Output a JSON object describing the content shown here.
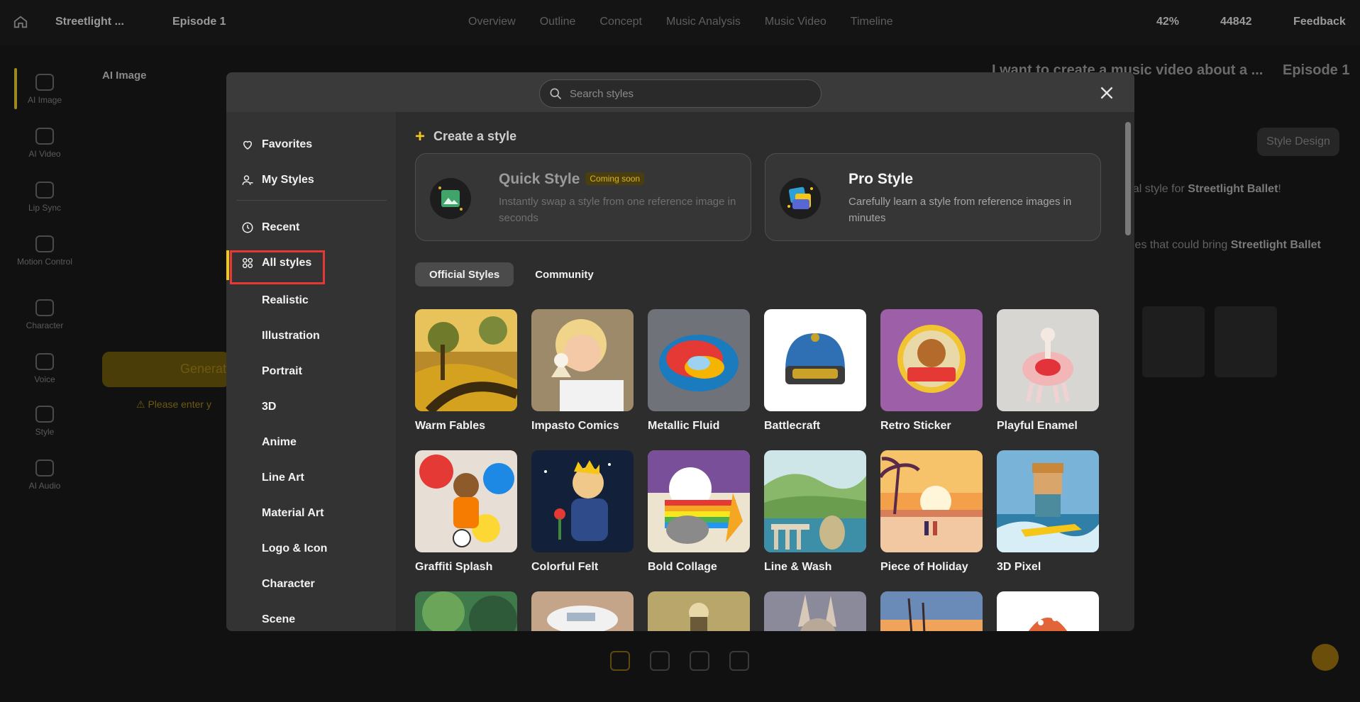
{
  "app": {
    "project": "Streetlight ...",
    "episode": "Episode 1",
    "nav": [
      "Overview",
      "Outline",
      "Concept",
      "Music Analysis",
      "Music Video",
      "Timeline"
    ],
    "zoom": "42%",
    "credits": "44842",
    "feedback": "Feedback"
  },
  "left_rail": [
    "AI Image",
    "AI Video",
    "Lip Sync",
    "Motion Control",
    "Character",
    "Voice",
    "Style",
    "AI Audio"
  ],
  "left_panel": {
    "title": "AI Image",
    "generate": "Generate",
    "warning": "Please enter y"
  },
  "right_panel": {
    "title": "I want to create a music video about a ...",
    "episode": "Episode 1",
    "style_design": "Style Design",
    "text1_pre": "ual style for ",
    "text1_bold": "Streetlight Ballet",
    "text1_post": "!",
    "text2_pre": "yles that could bring ",
    "text2_bold": "Streetlight Ballet"
  },
  "modal": {
    "search_placeholder": "Search styles",
    "sidebar": {
      "favorites": "Favorites",
      "my_styles": "My Styles",
      "recent": "Recent",
      "all_styles": "All styles",
      "categories": [
        "Realistic",
        "Illustration",
        "Portrait",
        "3D",
        "Anime",
        "Line Art",
        "Material Art",
        "Logo & Icon",
        "Character",
        "Scene"
      ]
    },
    "create_style": "Create a style",
    "quick_style": {
      "title": "Quick Style",
      "badge": "Coming soon",
      "desc": "Instantly swap a style from one reference image in seconds"
    },
    "pro_style": {
      "title": "Pro Style",
      "desc": "Carefully learn a style from reference images in minutes"
    },
    "tabs": [
      "Official Styles",
      "Community"
    ],
    "styles": [
      "Warm Fables",
      "Impasto Comics",
      "Metallic Fluid",
      "Battlecraft",
      "Retro Sticker",
      "Playful Enamel",
      "Graffiti Splash",
      "Colorful Felt",
      "Bold Collage",
      "Line & Wash",
      "Piece of Holiday",
      "3D Pixel"
    ]
  },
  "colors": {
    "accent": "#f5c518",
    "highlight": "#e53935",
    "modal_bg": "#2d2d2d"
  }
}
